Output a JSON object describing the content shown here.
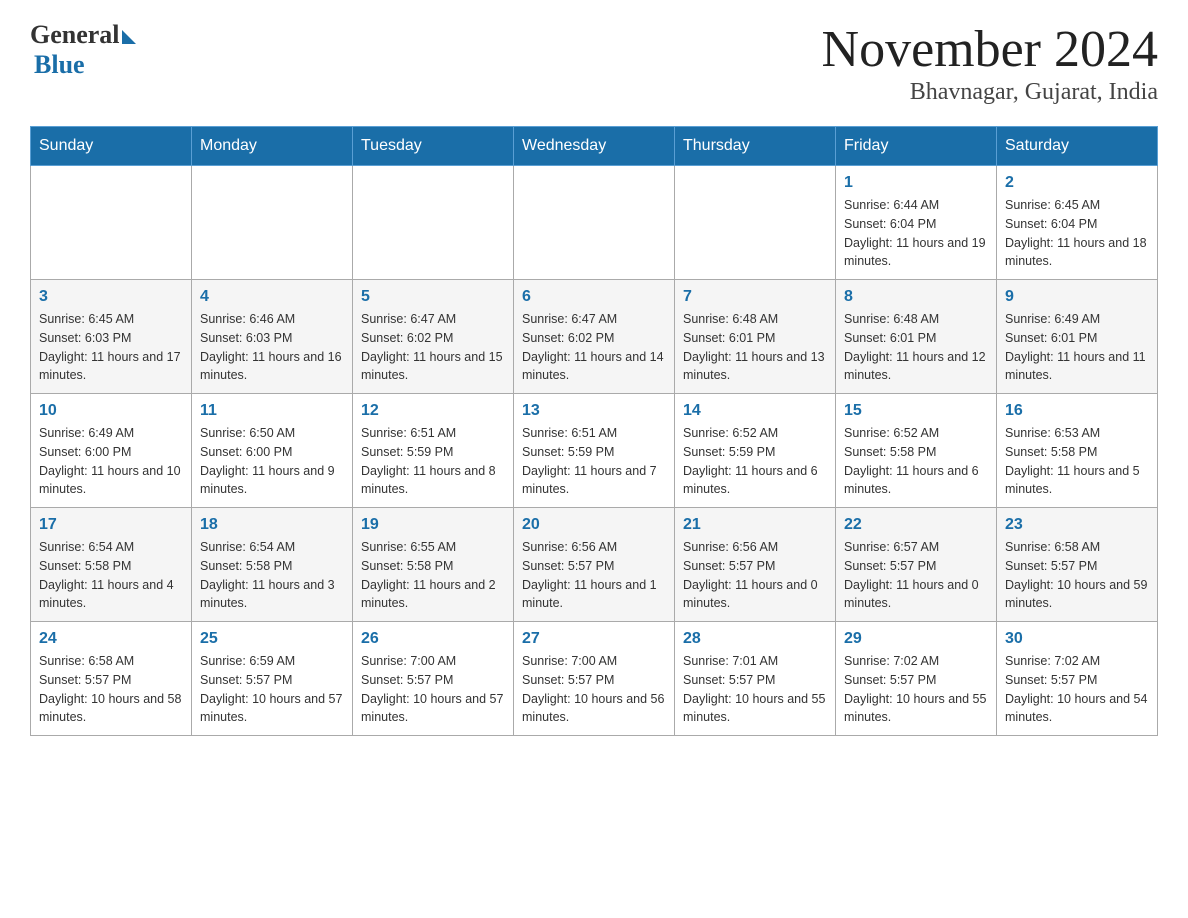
{
  "header": {
    "logo_general": "General",
    "logo_blue": "Blue",
    "month_title": "November 2024",
    "location": "Bhavnagar, Gujarat, India"
  },
  "days_of_week": [
    "Sunday",
    "Monday",
    "Tuesday",
    "Wednesday",
    "Thursday",
    "Friday",
    "Saturday"
  ],
  "weeks": [
    [
      {
        "day": "",
        "info": ""
      },
      {
        "day": "",
        "info": ""
      },
      {
        "day": "",
        "info": ""
      },
      {
        "day": "",
        "info": ""
      },
      {
        "day": "",
        "info": ""
      },
      {
        "day": "1",
        "info": "Sunrise: 6:44 AM\nSunset: 6:04 PM\nDaylight: 11 hours and 19 minutes."
      },
      {
        "day": "2",
        "info": "Sunrise: 6:45 AM\nSunset: 6:04 PM\nDaylight: 11 hours and 18 minutes."
      }
    ],
    [
      {
        "day": "3",
        "info": "Sunrise: 6:45 AM\nSunset: 6:03 PM\nDaylight: 11 hours and 17 minutes."
      },
      {
        "day": "4",
        "info": "Sunrise: 6:46 AM\nSunset: 6:03 PM\nDaylight: 11 hours and 16 minutes."
      },
      {
        "day": "5",
        "info": "Sunrise: 6:47 AM\nSunset: 6:02 PM\nDaylight: 11 hours and 15 minutes."
      },
      {
        "day": "6",
        "info": "Sunrise: 6:47 AM\nSunset: 6:02 PM\nDaylight: 11 hours and 14 minutes."
      },
      {
        "day": "7",
        "info": "Sunrise: 6:48 AM\nSunset: 6:01 PM\nDaylight: 11 hours and 13 minutes."
      },
      {
        "day": "8",
        "info": "Sunrise: 6:48 AM\nSunset: 6:01 PM\nDaylight: 11 hours and 12 minutes."
      },
      {
        "day": "9",
        "info": "Sunrise: 6:49 AM\nSunset: 6:01 PM\nDaylight: 11 hours and 11 minutes."
      }
    ],
    [
      {
        "day": "10",
        "info": "Sunrise: 6:49 AM\nSunset: 6:00 PM\nDaylight: 11 hours and 10 minutes."
      },
      {
        "day": "11",
        "info": "Sunrise: 6:50 AM\nSunset: 6:00 PM\nDaylight: 11 hours and 9 minutes."
      },
      {
        "day": "12",
        "info": "Sunrise: 6:51 AM\nSunset: 5:59 PM\nDaylight: 11 hours and 8 minutes."
      },
      {
        "day": "13",
        "info": "Sunrise: 6:51 AM\nSunset: 5:59 PM\nDaylight: 11 hours and 7 minutes."
      },
      {
        "day": "14",
        "info": "Sunrise: 6:52 AM\nSunset: 5:59 PM\nDaylight: 11 hours and 6 minutes."
      },
      {
        "day": "15",
        "info": "Sunrise: 6:52 AM\nSunset: 5:58 PM\nDaylight: 11 hours and 6 minutes."
      },
      {
        "day": "16",
        "info": "Sunrise: 6:53 AM\nSunset: 5:58 PM\nDaylight: 11 hours and 5 minutes."
      }
    ],
    [
      {
        "day": "17",
        "info": "Sunrise: 6:54 AM\nSunset: 5:58 PM\nDaylight: 11 hours and 4 minutes."
      },
      {
        "day": "18",
        "info": "Sunrise: 6:54 AM\nSunset: 5:58 PM\nDaylight: 11 hours and 3 minutes."
      },
      {
        "day": "19",
        "info": "Sunrise: 6:55 AM\nSunset: 5:58 PM\nDaylight: 11 hours and 2 minutes."
      },
      {
        "day": "20",
        "info": "Sunrise: 6:56 AM\nSunset: 5:57 PM\nDaylight: 11 hours and 1 minute."
      },
      {
        "day": "21",
        "info": "Sunrise: 6:56 AM\nSunset: 5:57 PM\nDaylight: 11 hours and 0 minutes."
      },
      {
        "day": "22",
        "info": "Sunrise: 6:57 AM\nSunset: 5:57 PM\nDaylight: 11 hours and 0 minutes."
      },
      {
        "day": "23",
        "info": "Sunrise: 6:58 AM\nSunset: 5:57 PM\nDaylight: 10 hours and 59 minutes."
      }
    ],
    [
      {
        "day": "24",
        "info": "Sunrise: 6:58 AM\nSunset: 5:57 PM\nDaylight: 10 hours and 58 minutes."
      },
      {
        "day": "25",
        "info": "Sunrise: 6:59 AM\nSunset: 5:57 PM\nDaylight: 10 hours and 57 minutes."
      },
      {
        "day": "26",
        "info": "Sunrise: 7:00 AM\nSunset: 5:57 PM\nDaylight: 10 hours and 57 minutes."
      },
      {
        "day": "27",
        "info": "Sunrise: 7:00 AM\nSunset: 5:57 PM\nDaylight: 10 hours and 56 minutes."
      },
      {
        "day": "28",
        "info": "Sunrise: 7:01 AM\nSunset: 5:57 PM\nDaylight: 10 hours and 55 minutes."
      },
      {
        "day": "29",
        "info": "Sunrise: 7:02 AM\nSunset: 5:57 PM\nDaylight: 10 hours and 55 minutes."
      },
      {
        "day": "30",
        "info": "Sunrise: 7:02 AM\nSunset: 5:57 PM\nDaylight: 10 hours and 54 minutes."
      }
    ]
  ]
}
